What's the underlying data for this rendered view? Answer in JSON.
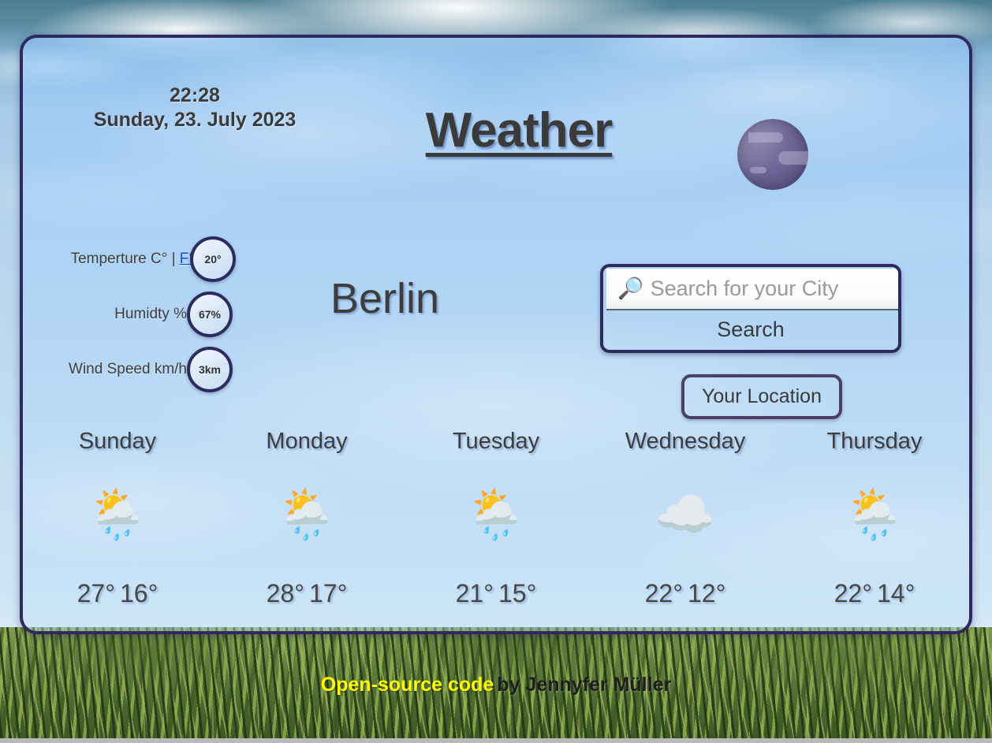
{
  "header": {
    "time": "22:28",
    "date": "Sunday, 23. July 2023",
    "title": "Weather",
    "globe_icon": "planet-globe-icon"
  },
  "metrics": [
    {
      "label_prefix": "Temperture C° | ",
      "unit_link": "F°",
      "label_suffix": "",
      "value": "20°",
      "name": "temperature"
    },
    {
      "label_prefix": "Humidty %",
      "unit_link": "",
      "label_suffix": "",
      "value": "67%",
      "name": "humidity"
    },
    {
      "label_prefix": "Wind Speed km/h",
      "unit_link": "",
      "label_suffix": "",
      "value": "3km",
      "name": "wind-speed"
    }
  ],
  "city": "Berlin",
  "search": {
    "icon": "magnifying-glass-icon",
    "placeholder": "Search for your City",
    "value": "",
    "button_label": "Search"
  },
  "location_button_label": "Your Location",
  "forecast": [
    {
      "day": "Sunday",
      "icon": "🌦️",
      "icon_name": "sun-behind-rain-cloud-icon",
      "high": "27°",
      "low": "16°"
    },
    {
      "day": "Monday",
      "icon": "🌦️",
      "icon_name": "sun-behind-rain-cloud-icon",
      "high": "28°",
      "low": "17°"
    },
    {
      "day": "Tuesday",
      "icon": "🌦️",
      "icon_name": "sun-behind-rain-cloud-icon",
      "high": "21°",
      "low": "15°"
    },
    {
      "day": "Wednesday",
      "icon": "☁️",
      "icon_name": "cloud-icon",
      "high": "22°",
      "low": "12°"
    },
    {
      "day": "Thursday",
      "icon": "🌦️",
      "icon_name": "sun-behind-rain-cloud-icon",
      "high": "22°",
      "low": "14°"
    }
  ],
  "footer": {
    "link_label": "Open-source code",
    "credit": "by Jennyfer Müller"
  },
  "colors": {
    "card_border": "#2d2a60",
    "link_yellow": "#ffff00",
    "unit_link_blue": "#1b49d8",
    "text_dark": "#3d3d3d"
  }
}
